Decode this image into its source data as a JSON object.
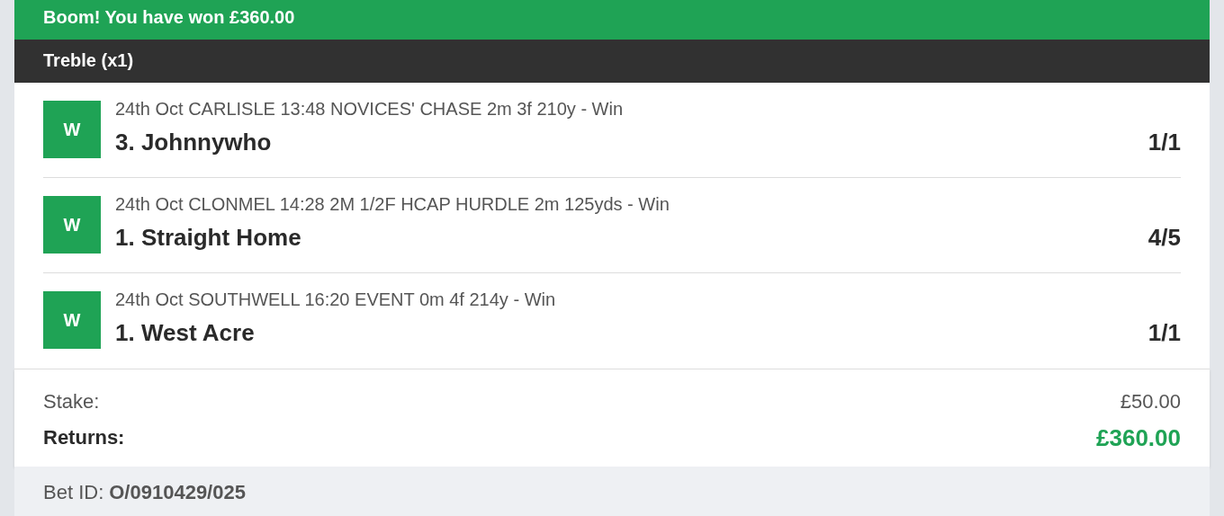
{
  "banner": "Boom! You have won £360.00",
  "bet_type": "Treble (x1)",
  "legs": [
    {
      "result": "W",
      "event": "24th Oct CARLISLE 13:48 NOVICES' CHASE 2m 3f 210y - Win",
      "selection": "3. Johnnywho",
      "odds": "1/1"
    },
    {
      "result": "W",
      "event": "24th Oct CLONMEL 14:28 2M 1/2F HCAP HURDLE 2m 125yds - Win",
      "selection": "1. Straight Home",
      "odds": "4/5"
    },
    {
      "result": "W",
      "event": "24th Oct SOUTHWELL 16:20 EVENT 0m 4f 214y - Win",
      "selection": "1. West Acre",
      "odds": "1/1"
    }
  ],
  "stake": {
    "label": "Stake:",
    "value": "£50.00"
  },
  "returns": {
    "label": "Returns:",
    "value": "£360.00"
  },
  "bet_id": {
    "label": "Bet ID:",
    "value": "O/0910429/025"
  }
}
